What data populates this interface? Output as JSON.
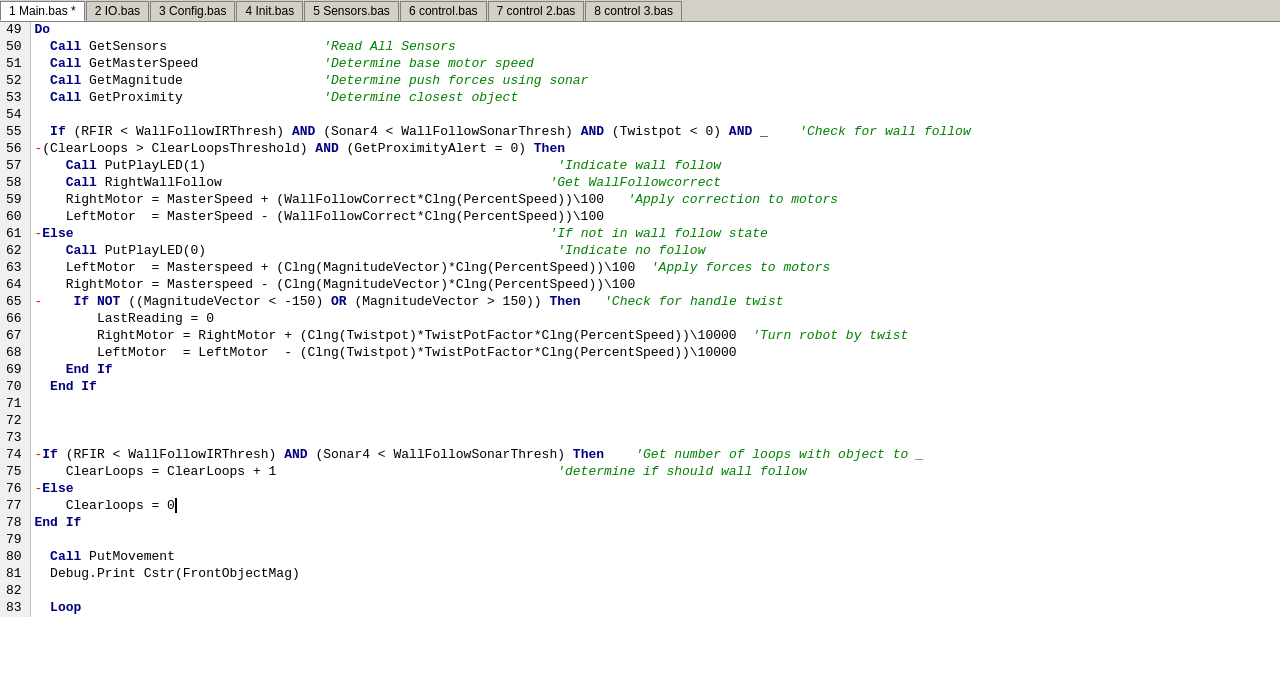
{
  "tabs": [
    {
      "label": "1 Main.bas *",
      "active": true
    },
    {
      "label": "2 IO.bas",
      "active": false
    },
    {
      "label": "3 Config.bas",
      "active": false
    },
    {
      "label": "4 Init.bas",
      "active": false
    },
    {
      "label": "5 Sensors.bas",
      "active": false
    },
    {
      "label": "6 control.bas",
      "active": false
    },
    {
      "label": "7 control 2.bas",
      "active": false
    },
    {
      "label": "8 control 3.bas",
      "active": false
    }
  ],
  "lines": [
    {
      "num": "49",
      "content": [
        {
          "type": "kw",
          "text": "Do"
        }
      ]
    },
    {
      "num": "50",
      "content": [
        {
          "type": "kw",
          "text": "  Call"
        },
        {
          "type": "plain",
          "text": " GetSensors                    "
        },
        {
          "type": "cmt",
          "text": "'Read All Sensors"
        }
      ]
    },
    {
      "num": "51",
      "content": [
        {
          "type": "kw",
          "text": "  Call"
        },
        {
          "type": "plain",
          "text": " GetMasterSpeed                "
        },
        {
          "type": "cmt",
          "text": "'Determine base motor speed"
        }
      ]
    },
    {
      "num": "52",
      "content": [
        {
          "type": "kw",
          "text": "  Call"
        },
        {
          "type": "plain",
          "text": " GetMagnitude                  "
        },
        {
          "type": "cmt",
          "text": "'Determine push forces using sonar"
        }
      ]
    },
    {
      "num": "53",
      "content": [
        {
          "type": "kw",
          "text": "  Call"
        },
        {
          "type": "plain",
          "text": " GetProximity                  "
        },
        {
          "type": "cmt",
          "text": "'Determine closest object"
        }
      ]
    },
    {
      "num": "54",
      "content": [
        {
          "type": "plain",
          "text": ""
        }
      ]
    },
    {
      "num": "55",
      "content": [
        {
          "type": "plain",
          "text": "  "
        },
        {
          "type": "kw",
          "text": "If"
        },
        {
          "type": "plain",
          "text": " (RFIR < WallFollowIRThresh) "
        },
        {
          "type": "kw",
          "text": "AND"
        },
        {
          "type": "plain",
          "text": " (Sonar4 < WallFollowSonarThresh) "
        },
        {
          "type": "kw",
          "text": "AND"
        },
        {
          "type": "plain",
          "text": " (Twistpot < 0) "
        },
        {
          "type": "kw",
          "text": "AND"
        },
        {
          "type": "plain",
          "text": " _    "
        },
        {
          "type": "cmt",
          "text": "'Check for wall follow"
        }
      ]
    },
    {
      "num": "56",
      "content": [
        {
          "type": "minus",
          "text": "-"
        },
        {
          "type": "plain",
          "text": "(ClearLoops > ClearLoopsThreshold) "
        },
        {
          "type": "kw",
          "text": "AND"
        },
        {
          "type": "plain",
          "text": " (GetProximityAlert = 0) "
        },
        {
          "type": "kw",
          "text": "Then"
        }
      ]
    },
    {
      "num": "57",
      "content": [
        {
          "type": "kw",
          "text": "    Call"
        },
        {
          "type": "plain",
          "text": " PutPlayLED(1)                                             "
        },
        {
          "type": "cmt",
          "text": "'Indicate wall follow"
        }
      ]
    },
    {
      "num": "58",
      "content": [
        {
          "type": "kw",
          "text": "    Call"
        },
        {
          "type": "plain",
          "text": " RightWallFollow                                          "
        },
        {
          "type": "cmt",
          "text": "'Get WallFollowcorrect"
        }
      ]
    },
    {
      "num": "59",
      "content": [
        {
          "type": "plain",
          "text": "    RightMotor = MasterSpeed + (WallFollowCorrect*Clng(PercentSpeed))\\100   "
        },
        {
          "type": "cmt",
          "text": "'Apply correction to motors"
        }
      ]
    },
    {
      "num": "60",
      "content": [
        {
          "type": "plain",
          "text": "    LeftMotor  = MasterSpeed - (WallFollowCorrect*Clng(PercentSpeed))\\100"
        }
      ]
    },
    {
      "num": "61",
      "content": [
        {
          "type": "minus",
          "text": "-"
        },
        {
          "type": "kw",
          "text": "Else"
        },
        {
          "type": "plain",
          "text": "                                                             "
        },
        {
          "type": "cmt",
          "text": "'If not in wall follow state"
        }
      ]
    },
    {
      "num": "62",
      "content": [
        {
          "type": "kw",
          "text": "    Call"
        },
        {
          "type": "plain",
          "text": " PutPlayLED(0)                                             "
        },
        {
          "type": "cmt",
          "text": "'Indicate no follow"
        }
      ]
    },
    {
      "num": "63",
      "content": [
        {
          "type": "plain",
          "text": "    LeftMotor  = Masterspeed + (Clng(MagnitudeVector)*Clng(PercentSpeed))\\100  "
        },
        {
          "type": "cmt",
          "text": "'Apply forces to motors"
        }
      ]
    },
    {
      "num": "64",
      "content": [
        {
          "type": "plain",
          "text": "    RightMotor = Masterspeed - (Clng(MagnitudeVector)*Clng(PercentSpeed))\\100"
        }
      ]
    },
    {
      "num": "65",
      "content": [
        {
          "type": "minus",
          "text": "-"
        },
        {
          "type": "plain",
          "text": "    "
        },
        {
          "type": "kw",
          "text": "If NOT"
        },
        {
          "type": "plain",
          "text": " ((MagnitudeVector < -150) "
        },
        {
          "type": "kw",
          "text": "OR"
        },
        {
          "type": "plain",
          "text": " (MagnitudeVector > 150)) "
        },
        {
          "type": "kw",
          "text": "Then"
        },
        {
          "type": "plain",
          "text": "   "
        },
        {
          "type": "cmt",
          "text": "'Check for handle twist"
        }
      ]
    },
    {
      "num": "66",
      "content": [
        {
          "type": "plain",
          "text": "        LastReading = 0"
        }
      ]
    },
    {
      "num": "67",
      "content": [
        {
          "type": "plain",
          "text": "        RightMotor = RightMotor + (Clng(Twistpot)*TwistPotFactor*Clng(PercentSpeed))\\10000  "
        },
        {
          "type": "cmt",
          "text": "'Turn robot by twist"
        }
      ]
    },
    {
      "num": "68",
      "content": [
        {
          "type": "plain",
          "text": "        LeftMotor  = LeftMotor  - (Clng(Twistpot)*TwistPotFactor*Clng(PercentSpeed))\\10000"
        }
      ]
    },
    {
      "num": "69",
      "content": [
        {
          "type": "kw",
          "text": "    End If"
        }
      ]
    },
    {
      "num": "70",
      "content": [
        {
          "type": "kw",
          "text": "  End If"
        }
      ]
    },
    {
      "num": "71",
      "content": [
        {
          "type": "plain",
          "text": ""
        }
      ]
    },
    {
      "num": "72",
      "content": [
        {
          "type": "plain",
          "text": ""
        }
      ]
    },
    {
      "num": "73",
      "content": [
        {
          "type": "plain",
          "text": ""
        }
      ]
    },
    {
      "num": "74",
      "content": [
        {
          "type": "minus",
          "text": "-"
        },
        {
          "type": "kw",
          "text": "If"
        },
        {
          "type": "plain",
          "text": " (RFIR < WallFollowIRThresh) "
        },
        {
          "type": "kw",
          "text": "AND"
        },
        {
          "type": "plain",
          "text": " (Sonar4 < WallFollowSonarThresh) "
        },
        {
          "type": "kw",
          "text": "Then"
        },
        {
          "type": "plain",
          "text": "    "
        },
        {
          "type": "cmt",
          "text": "'Get number of loops with object to _"
        }
      ]
    },
    {
      "num": "75",
      "content": [
        {
          "type": "plain",
          "text": "    ClearLoops = ClearLoops + 1                                    "
        },
        {
          "type": "cmt",
          "text": "'determine if should wall follow"
        }
      ]
    },
    {
      "num": "76",
      "content": [
        {
          "type": "minus",
          "text": "-"
        },
        {
          "type": "kw",
          "text": "Else"
        }
      ]
    },
    {
      "num": "77",
      "content": [
        {
          "type": "plain",
          "text": "    Clearloops = 0"
        },
        {
          "type": "cursor",
          "text": ""
        }
      ]
    },
    {
      "num": "78",
      "content": [
        {
          "type": "kw",
          "text": "End If"
        }
      ]
    },
    {
      "num": "79",
      "content": [
        {
          "type": "plain",
          "text": ""
        }
      ]
    },
    {
      "num": "80",
      "content": [
        {
          "type": "kw",
          "text": "  Call"
        },
        {
          "type": "plain",
          "text": " PutMovement"
        }
      ]
    },
    {
      "num": "81",
      "content": [
        {
          "type": "plain",
          "text": "  Debug.Print Cstr(FrontObjectMag)"
        }
      ]
    },
    {
      "num": "82",
      "content": [
        {
          "type": "plain",
          "text": ""
        }
      ]
    },
    {
      "num": "83",
      "content": [
        {
          "type": "kw",
          "text": "  Loop"
        }
      ]
    }
  ]
}
